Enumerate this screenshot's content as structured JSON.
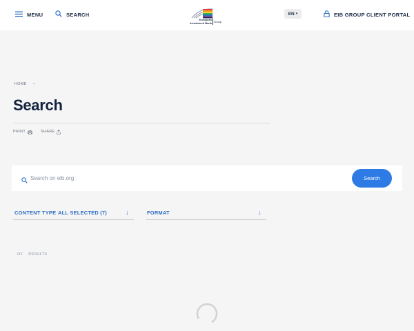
{
  "header": {
    "menu_label": "MENU",
    "search_label": "SEARCH",
    "language": "EN",
    "portal_label": "EIB GROUP CLIENT PORTAL",
    "logo": {
      "line1": "European",
      "line2": "Investment Bank",
      "group": "Group"
    }
  },
  "breadcrumb": {
    "home_label": "HOME"
  },
  "page": {
    "title": "Search",
    "print_label": "PRINT",
    "share_label": "SHARE"
  },
  "search": {
    "placeholder": "Search on eib.org",
    "value": "",
    "button_label": "Search"
  },
  "filters": {
    "content_type": {
      "label": "CONTENT TYPE",
      "selected": "ALL SELECTED (7)"
    },
    "format": {
      "label": "FORMAT"
    }
  },
  "results": {
    "of_label": "OF",
    "results_label": "RESULTS"
  },
  "colors": {
    "accent": "#2f7be6",
    "link": "#2f6fc4",
    "text": "#1b2a44",
    "background": "#f5f5f5"
  },
  "icons": [
    "menu-icon",
    "search-icon",
    "lock-icon",
    "print-icon",
    "share-icon",
    "arrow-right-icon",
    "arrow-down-icon",
    "loading-spinner"
  ]
}
